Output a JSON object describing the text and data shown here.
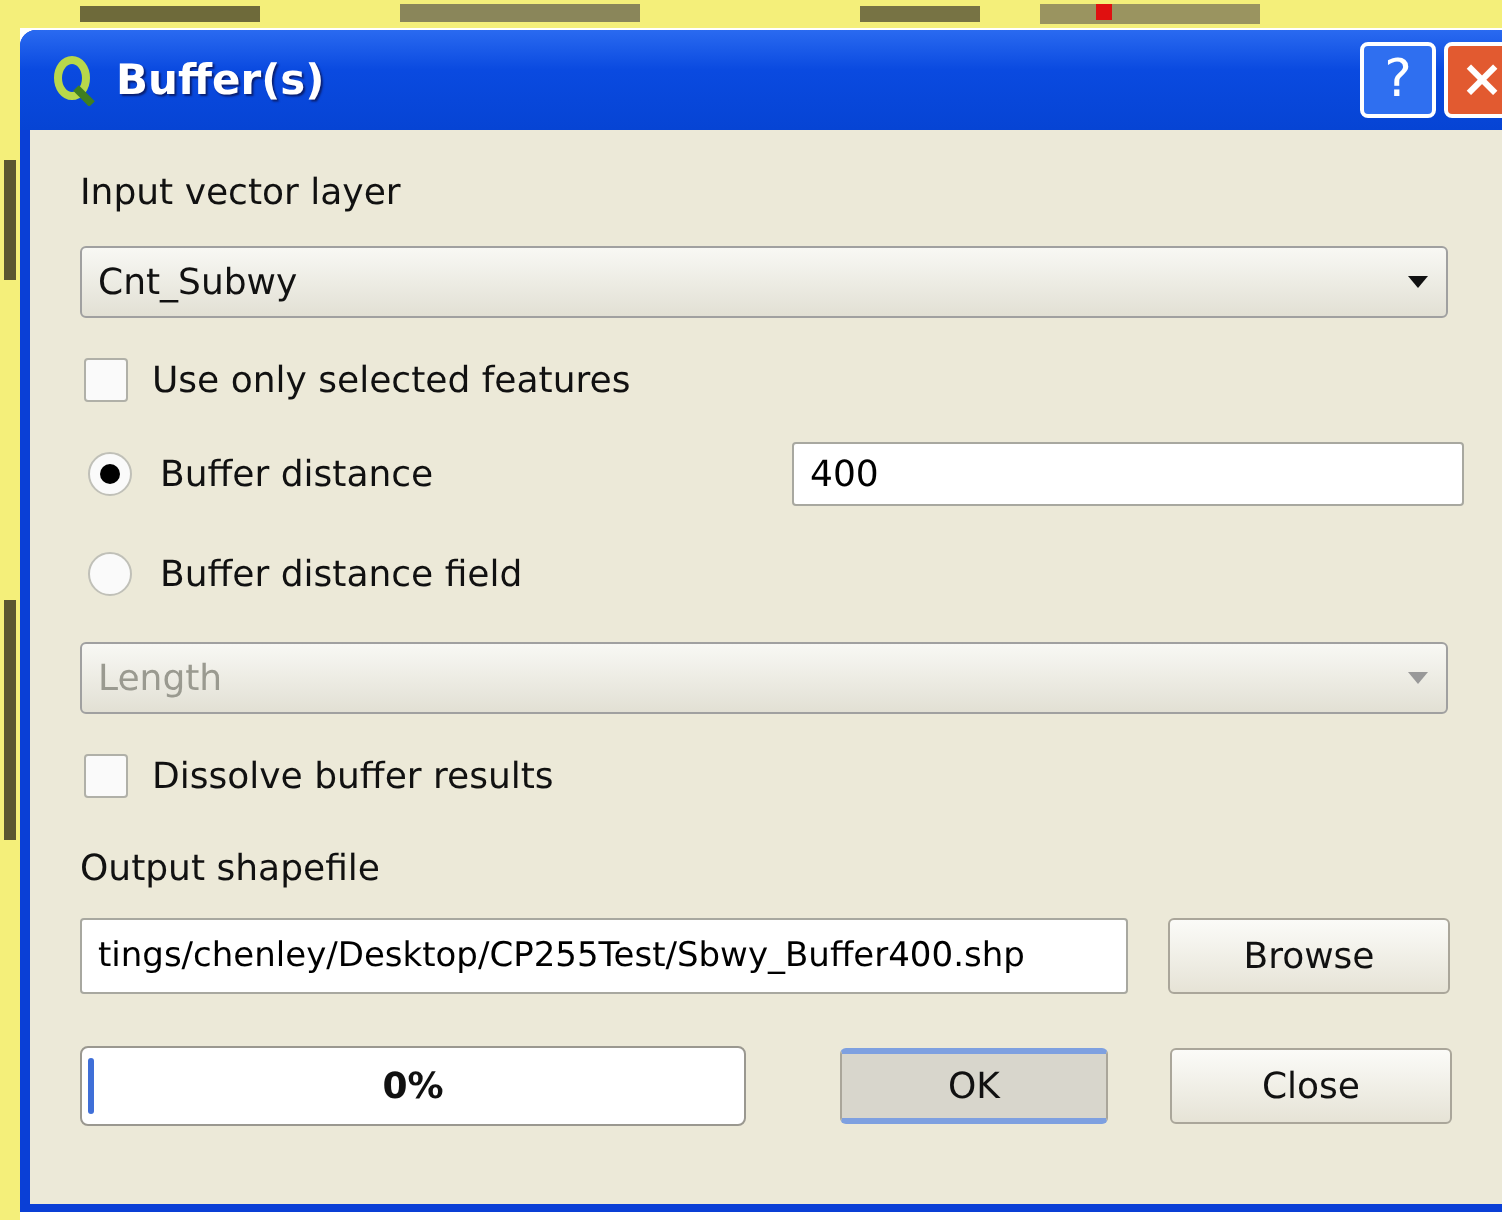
{
  "window": {
    "title": "Buffer(s)",
    "buttons": [
      {
        "kind": "help",
        "label": "?"
      },
      {
        "kind": "close",
        "label": "×"
      }
    ]
  },
  "input_layer": {
    "label": "Input vector layer",
    "value": "Cnt_Subwy",
    "disabled": false
  },
  "use_selected": {
    "label": "Use only selected features",
    "checked": false
  },
  "distance_options": [
    {
      "label": "Buffer distance",
      "selected": true,
      "value": "400"
    },
    {
      "label": "Buffer distance field",
      "selected": false
    }
  ],
  "distance_field": {
    "value": "Length",
    "disabled": true
  },
  "dissolve": {
    "label": "Dissolve buffer results",
    "checked": false
  },
  "output": {
    "label": "Output shapefile",
    "value": "tings/chenley/Desktop/CP255Test/Sbwy_Buffer400.shp",
    "browse": "Browse"
  },
  "progress": {
    "level": 0.01,
    "text": "0%"
  },
  "buttons": [
    {
      "label": "OK",
      "default": true
    },
    {
      "label": "Close",
      "default": false
    }
  ]
}
